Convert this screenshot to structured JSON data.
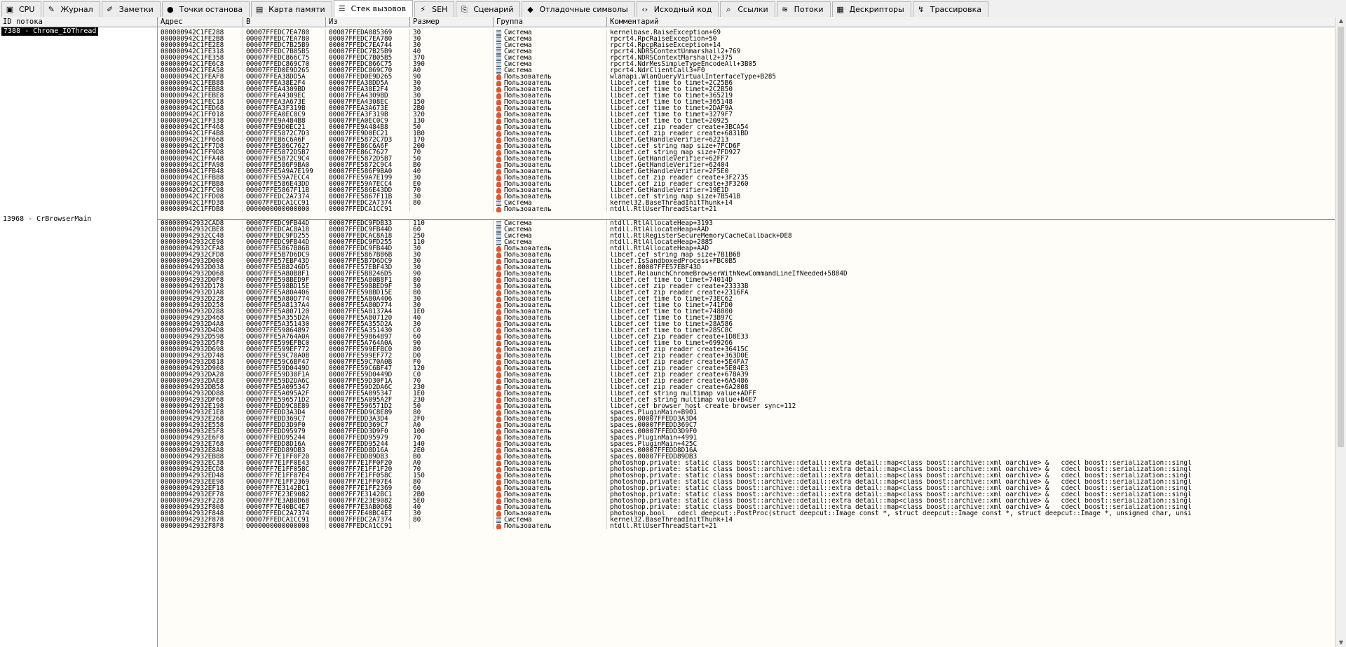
{
  "tabs": [
    {
      "label": "CPU",
      "icon": "cpu-icon",
      "glyph": "▣",
      "active": false
    },
    {
      "label": "Журнал",
      "icon": "log-icon",
      "glyph": "✎",
      "active": false
    },
    {
      "label": "Заметки",
      "icon": "notes-icon",
      "glyph": "✐",
      "active": false
    },
    {
      "label": "Точки останова",
      "icon": "breakpoint-icon",
      "glyph": "●",
      "active": false
    },
    {
      "label": "Карта памяти",
      "icon": "memory-map-icon",
      "glyph": "▤",
      "active": false
    },
    {
      "label": "Стек вызовов",
      "icon": "call-stack-icon",
      "glyph": "☰",
      "active": true
    },
    {
      "label": "SEH",
      "icon": "seh-icon",
      "glyph": "⚡",
      "active": false
    },
    {
      "label": "Сценарий",
      "icon": "script-icon",
      "glyph": "⎘",
      "active": false
    },
    {
      "label": "Отладочные символы",
      "icon": "symbols-icon",
      "glyph": "◆",
      "active": false
    },
    {
      "label": "Исходный код",
      "icon": "source-icon",
      "glyph": "‹›",
      "active": false
    },
    {
      "label": "Ссылки",
      "icon": "references-icon",
      "glyph": "⌕",
      "active": false
    },
    {
      "label": "Потоки",
      "icon": "threads-icon",
      "glyph": "≋",
      "active": false
    },
    {
      "label": "Дескрипторы",
      "icon": "handles-icon",
      "glyph": "▦",
      "active": false
    },
    {
      "label": "Трассировка",
      "icon": "trace-icon",
      "glyph": "↯",
      "active": false
    }
  ],
  "columns": {
    "tid": "ID потока",
    "addr": "Адрес",
    "to": "В",
    "from": "Из",
    "size": "Размер",
    "group": "Группа",
    "comment": "Комментарий"
  },
  "groups": {
    "sys": "Система",
    "usr": "Пользователь"
  },
  "threads": [
    {
      "id": "7388 - Chrome_IOThread",
      "selected": true,
      "frames": [
        [
          "000000942C1FE288",
          "00007FFEDC7EA780",
          "00007FFEDA085369",
          "30",
          "sys",
          "kernelbase.RaiseException+69"
        ],
        [
          "000000942C1FE2B8",
          "00007FFEDC7EA780",
          "00007FFEDC7EA780",
          "30",
          "sys",
          "rpcrt4.RpcRaiseException+50"
        ],
        [
          "000000942C1FE2E8",
          "00007FFEDC7B25B9",
          "00007FFEDC7EA744",
          "30",
          "sys",
          "rpcrt4.RpcpRaiseException+14"
        ],
        [
          "000000942C1FE318",
          "00007FFEDC7B05B5",
          "00007FFEDC7B25B9",
          "40",
          "sys",
          "rpcrt4.NDRSContextUnmarshall2+769"
        ],
        [
          "000000942C1FE358",
          "00007FFEDC866C75",
          "00007FFEDC7B05B5",
          "370",
          "sys",
          "rpcrt4.NDRSContextMarshall2+375"
        ],
        [
          "000000942C1FE6C8",
          "00007FFEDC869C70",
          "00007FFEDC866C75",
          "390",
          "sys",
          "rpcrt4.NdrMesSimpleTypeEncodeAll+3B05"
        ],
        [
          "000000942C1FEA58",
          "00007FFED0E9D265",
          "00007FFEDC869C70",
          "A0",
          "sys",
          "rpcrt4.NdrClientCall3+F0"
        ],
        [
          "000000942C1FEAF8",
          "00007FFEA38DD5A",
          "00007FFED0E9D265",
          "90",
          "usr",
          "wlanapi.WlanQueryVirtualInterfaceType+B285"
        ],
        [
          "000000942C1FEB88",
          "00007FFEA38E2F4",
          "00007FFEA38DD5A",
          "30",
          "usr",
          "libcef.cef_time_to_timet+2C25B6"
        ],
        [
          "000000942C1FEBB8",
          "00007FFEA4309BD",
          "00007FFEA38E2F4",
          "30",
          "usr",
          "libcef.cef_time_to_timet+2C2B50"
        ],
        [
          "000000942C1FEBE8",
          "00007FFEA4309EC",
          "00007FFEA4309BD",
          "30",
          "usr",
          "libcef.cef_time_to_timet+365219"
        ],
        [
          "000000942C1FEC18",
          "00007FFEA3A673E",
          "00007FFEA4308EC",
          "150",
          "usr",
          "libcef.cef_time_to_timet+365148"
        ],
        [
          "000000942C1FED68",
          "00007FFEA3F319B",
          "00007FFEA3A673E",
          "2B0",
          "usr",
          "libcef.cef_time_to_timet+2DAF9A"
        ],
        [
          "000000942C1FF018",
          "00007FFEA0EC0C9",
          "00007FFEA3F319B",
          "320",
          "usr",
          "libcef.cef_time_to_timet+3279F7"
        ],
        [
          "000000942C1FF338",
          "00007FFE9A484B8",
          "00007FFEA0EC0C9",
          "130",
          "usr",
          "libcef.cef_time_to_timet+20925"
        ],
        [
          "000000942C1FF468",
          "00007FFE9D0EC21",
          "00007FFE9A484B8",
          "50",
          "usr",
          "libcef.cef_zip_reader_create+3BCA54"
        ],
        [
          "000000942C1FF4B8",
          "00007FFE5872C7D3",
          "00007FFE9D0EC21",
          "1B0",
          "usr",
          "libcef.cef_zip_reader_create+6831BD"
        ],
        [
          "000000942C1FF668",
          "00007FFE86C6A6F",
          "00007FFE5872C7D3",
          "170",
          "usr",
          "libcef.GetHandleVerifier+62213"
        ],
        [
          "000000942C1FF7D8",
          "00007FFE586C7627",
          "00007FFE86C6A6F",
          "200",
          "usr",
          "libcef.cef_string_map_size+7FCD6F"
        ],
        [
          "000000942C1FF9D8",
          "00007FFE5872D5B7",
          "00007FFE86C7627",
          "70",
          "usr",
          "libcef.cef_string_map_size+7FD927"
        ],
        [
          "000000942C1FFA48",
          "00007FFE5872C9C4",
          "00007FFE5872D5B7",
          "50",
          "usr",
          "libcef.GetHandleVerifier+62FF7"
        ],
        [
          "000000942C1FFA98",
          "00007FFE586F9BA0",
          "00007FFE5872C9C4",
          "B0",
          "usr",
          "libcef.GetHandleVerifier+62404"
        ],
        [
          "000000942C1FFB48",
          "00007FFE5A9A7E199",
          "00007FFE586F9BA0",
          "40",
          "usr",
          "libcef.GetHandleVerifier+2F5E0"
        ],
        [
          "000000942C1FFB88",
          "00007FFE59A7ECC4",
          "00007FFE59A7E199",
          "30",
          "usr",
          "libcef.cef_zip_reader_create+3F2735"
        ],
        [
          "000000942C1FFBB8",
          "00007FFE586E43DD",
          "00007FFE59A7ECC4",
          "E0",
          "usr",
          "libcef.cef_zip_reader_create+3F3260"
        ],
        [
          "000000942C1FFC98",
          "00007FFE5867F11B",
          "00007FFE586E43DD",
          "70",
          "usr",
          "libcef.GetHandleVerifier+19E1D"
        ],
        [
          "000000942C1FFD08",
          "00007FFEDC2A7374",
          "00007FFE5867F11B",
          "30",
          "usr",
          "libcef.cef_string_map_size+7B541B"
        ],
        [
          "000000942C1FFD38",
          "00007FFEDCA1CC91",
          "00007FFEDC2A7374",
          "80",
          "sys",
          "kernel32.BaseThreadInitThunk+14"
        ],
        [
          "000000942C1FFDB8",
          "0000000000000000",
          "00007FFEDCA1CC91",
          "",
          "usr",
          "ntdll.RtlUserThreadStart+21"
        ]
      ]
    },
    {
      "id": "13968 - CrBrowserMain",
      "selected": false,
      "frames": [
        [
          "000000942932CAD8",
          "00007FFEDC9FB44D",
          "00007FFEDC9FDB33",
          "110",
          "sys",
          "ntdll.RtlAllocateHeap+3193"
        ],
        [
          "000000942932CBE8",
          "00007FFEDCAC8A18",
          "00007FFEDC9FB44D",
          "60",
          "sys",
          "ntdll.RtlAllocateHeap+AAD"
        ],
        [
          "000000942932CC48",
          "00007FFEDC9FD255",
          "00007FFEDCAC8A18",
          "250",
          "sys",
          "ntdll.RtlRegisterSecureMemoryCacheCallback+DE8"
        ],
        [
          "000000942932CE98",
          "00007FFEDC9FB44D",
          "00007FFEDC9FD255",
          "110",
          "sys",
          "ntdll.RtlAllocateHeap+2885"
        ],
        [
          "000000942932CFA8",
          "00007FFE5867B86B",
          "00007FFEDC9FB44D",
          "30",
          "usr",
          "ntdll.RtlAllocateHeap+AAD"
        ],
        [
          "000000942932CFD8",
          "00007FFE5B7D6DC9",
          "00007FFE5867B86B",
          "30",
          "usr",
          "libcef.cef_string_map_size+7B1B6B"
        ],
        [
          "000000942932D008",
          "00007FFE57EBF43D",
          "00007FFE5B7D6DC9",
          "30",
          "usr",
          "libcef.IsSandboxedProcess+FBC0B5"
        ],
        [
          "000000942932D038",
          "00007FFE5B8246D5",
          "00007FFE57EBF43D",
          "30",
          "usr",
          "libcef.00007FFE57EBF43D"
        ],
        [
          "000000942932D068",
          "00007FFE5A80B8F1",
          "00007FFE5B8246D5",
          "90",
          "usr",
          "libcef.RelaunchChromeBrowserWithNewCommandLineIfNeeded+5884D"
        ],
        [
          "000000942932D0F8",
          "00007FFE598BED9F",
          "00007FFE5A80B8F1",
          "80",
          "usr",
          "libcef.cef_time_to_timet+74014D"
        ],
        [
          "000000942932D178",
          "00007FFE598BD15E",
          "00007FFE598BED9F",
          "30",
          "usr",
          "libcef.cef_zip_reader_create+23333B"
        ],
        [
          "000000942932D1A8",
          "00007FFE5A80A406",
          "00007FFE598BD15E",
          "80",
          "usr",
          "libcef.cef_zip_reader_create+2316FA"
        ],
        [
          "000000942932D228",
          "00007FFE5A80D774",
          "00007FFE5A80A406",
          "30",
          "usr",
          "libcef.cef_time_to_timet+73EC62"
        ],
        [
          "000000942932D258",
          "00007FFE5A8137A4",
          "00007FFE5A80D774",
          "30",
          "usr",
          "libcef.cef_time_to_timet+741FD0"
        ],
        [
          "000000942932D288",
          "00007FFE5A807120",
          "00007FFE5A8137A4",
          "1E0",
          "usr",
          "libcef.cef_time_to_timet+748000"
        ],
        [
          "000000942932D468",
          "00007FFE5A355D2A",
          "00007FFE5A807120",
          "40",
          "usr",
          "libcef.cef_time_to_timet+73B97C"
        ],
        [
          "000000942932D4A8",
          "00007FFE5A351430",
          "00007FFE5A355D2A",
          "30",
          "usr",
          "libcef.cef_time_to_timet+28A586"
        ],
        [
          "000000942932D4D8",
          "00007FFE59864897",
          "00007FFE5A351430",
          "C0",
          "usr",
          "libcef.cef_time_to_timet+285C8C"
        ],
        [
          "000000942932D598",
          "00007FFE5A764A0A",
          "00007FFE59864897",
          "60",
          "usr",
          "libcef.cef_zip_reader_create+1D8E33"
        ],
        [
          "000000942932D5F8",
          "00007FFE599EFBC0",
          "00007FFE5A764A0A",
          "90",
          "usr",
          "libcef.cef_time_to_timet+699266"
        ],
        [
          "000000942932D698",
          "00007FFE599EF772",
          "00007FFE599EFBC0",
          "80",
          "usr",
          "libcef.cef_zip_reader_create+36415C"
        ],
        [
          "000000942932D748",
          "00007FFE59C70A0B",
          "00007FFE599EF772",
          "D0",
          "usr",
          "libcef.cef_zip_reader_create+363D0E"
        ],
        [
          "000000942932D818",
          "00007FFE59C6BF47",
          "00007FFE59C70A0B",
          "F0",
          "usr",
          "libcef.cef_zip_reader_create+5E4FA7"
        ],
        [
          "000000942932D908",
          "00007FFE59D0449D",
          "00007FFE59C6BF47",
          "120",
          "usr",
          "libcef.cef_zip_reader_create+5E04E3"
        ],
        [
          "000000942932DA28",
          "00007FFE59D30F1A",
          "00007FFE59D0449D",
          "C0",
          "usr",
          "libcef.cef_zip_reader_create+678A39"
        ],
        [
          "000000942932DAE8",
          "00007FFE59D2DA6C",
          "00007FFE59D30F1A",
          "70",
          "usr",
          "libcef.cef_zip_reader_create+6A5486"
        ],
        [
          "000000942932DB58",
          "00007FFE5A095347",
          "00007FFE59D2DA6C",
          "230",
          "usr",
          "libcef.cef_zip_reader_create+6A2008"
        ],
        [
          "000000942932DD88",
          "00007FFE5A095A2F",
          "00007FFE5A095347",
          "1E0",
          "usr",
          "libcef.cef_string_multimap_value+ADFF"
        ],
        [
          "000000942932DF68",
          "00007FFE596571D2",
          "00007FFE5A095A2F",
          "230",
          "usr",
          "libcef.cef_string_multimap_value+B4E7"
        ],
        [
          "000000942932E198",
          "00007FFEDD9C8E89",
          "00007FFE596571D2",
          "50",
          "usr",
          "libcef.cef_browser_host_create_browser_sync+112"
        ],
        [
          "000000942932E1E8",
          "00007FFEDD3A3D4",
          "00007FFEDD9C8E89",
          "80",
          "usr",
          "spaces.PluginMain+B901"
        ],
        [
          "000000942932E268",
          "00007FFEDD369C7",
          "00007FFEDD3A3D4",
          "2F0",
          "usr",
          "spaces.00007FFEDD3A3D4"
        ],
        [
          "000000942932E558",
          "00007FFEDD3D9F0",
          "00007FFEDD369C7",
          "A0",
          "usr",
          "spaces.00007FFEDD369C7"
        ],
        [
          "000000942932E5F8",
          "00007FFEDD95979",
          "00007FFEDD3D9F0",
          "100",
          "usr",
          "spaces.00007FFEDD3D9F0"
        ],
        [
          "000000942932E6F8",
          "00007FFEDD95244",
          "00007FFEDD95979",
          "70",
          "usr",
          "spaces.PluginMain+4991"
        ],
        [
          "000000942932E768",
          "00007FFEDD8D16A",
          "00007FFEDD95244",
          "140",
          "usr",
          "spaces.PluginMain+425C"
        ],
        [
          "000000942932E8A8",
          "00007FFEDD89DB3",
          "00007FFEDD8D16A",
          "2E0",
          "usr",
          "spaces.00007FFEDD8D16A"
        ],
        [
          "000000942932EB88",
          "00007FF7E1FF0F20",
          "00007FFEDD89DB3",
          "B0",
          "usr",
          "spaces.00007FFEDD89DB3"
        ],
        [
          "000000942932EC38",
          "00007FF7E1FF0E43",
          "00007FF7E1FF0F20",
          "A0",
          "usr",
          "photoshop.private: static class boost::archive::detail::extra_detail::map<class boost::archive::xml_oarchive> & __cdecl boost::serialization::singl"
        ],
        [
          "000000942932ECD8",
          "00007FF7E1FF058C",
          "00007FF7E1FF1F20",
          "70",
          "usr",
          "photoshop.private: static class boost::archive::detail::extra_detail::map<class boost::archive::xml_oarchive> & __cdecl boost::serialization::singl"
        ],
        [
          "000000942932ED48",
          "00007FF7E1FF07E4",
          "00007FF7E1FF058C",
          "150",
          "usr",
          "photoshop.private: static class boost::archive::detail::extra_detail::map<class boost::archive::xml_oarchive> & __cdecl boost::serialization::singl"
        ],
        [
          "000000942932EE98",
          "00007FF7E1FF2369",
          "00007FF7E1FF07E4",
          "80",
          "usr",
          "photoshop.private: static class boost::archive::detail::extra_detail::map<class boost::archive::xml_oarchive> & __cdecl boost::serialization::singl"
        ],
        [
          "000000942932EF18",
          "00007FF7E3142BC1",
          "00007FF7E1FF2369",
          "60",
          "usr",
          "photoshop.private: static class boost::archive::detail::extra_detail::map<class boost::archive::xml_oarchive> & __cdecl boost::serialization::singl"
        ],
        [
          "000000942932EF78",
          "00007FF7E23E9082",
          "00007FF7E3142BC1",
          "2B0",
          "usr",
          "photoshop.private: static class boost::archive::detail::extra_detail::map<class boost::archive::xml_oarchive> & __cdecl boost::serialization::singl"
        ],
        [
          "000000942932F228",
          "00007FF7E3AB0D68",
          "00007FF7E23E9082",
          "5E0",
          "usr",
          "photoshop.private: static class boost::archive::detail::extra_detail::map<class boost::archive::xml_oarchive> & __cdecl boost::serialization::singl"
        ],
        [
          "000000942932F808",
          "00007FF7E40BC4E7",
          "00007FF7E3AB0D68",
          "40",
          "usr",
          "photoshop.private: static class boost::archive::detail::extra_detail::map<class boost::archive::xml_oarchive> & __cdecl boost::serialization::singl"
        ],
        [
          "000000942932F848",
          "00007FFEDC2A7374",
          "00007FF7E40BC4E7",
          "30",
          "usr",
          "photoshop.bool __cdecl deepcut::PostProc(struct deepcut::Image const *, struct deepcut::Image const *, struct deepcut::Image *, unsigned char, unsi"
        ],
        [
          "000000942932F878",
          "00007FFEDCA1CC91",
          "00007FFEDC2A7374",
          "80",
          "sys",
          "kernel32.BaseThreadInitThunk+14"
        ],
        [
          "000000942932F8F8",
          "0000000000000000",
          "00007FFEDCA1CC91",
          "",
          "usr",
          "ntdll.RtlUserThreadStart+21"
        ]
      ]
    }
  ]
}
